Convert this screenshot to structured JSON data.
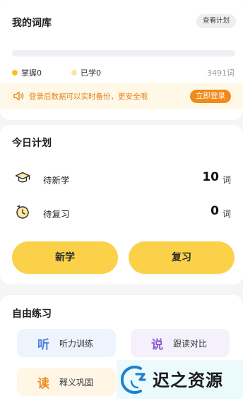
{
  "vocab": {
    "title": "我的词库",
    "plan_button": "查看计划",
    "progress": 0,
    "mastered_label": "掌握0",
    "learned_label": "已学0",
    "total_label": "3491词",
    "colors": {
      "mastered_dot": "#f8c31c",
      "learned_dot": "#fbe5a8"
    }
  },
  "login_bar": {
    "message": "登录后数据可以实时备份，更安全哦",
    "button": "立即登录",
    "icon": "speaker-icon"
  },
  "today": {
    "title": "今日计划",
    "rows": [
      {
        "label": "待新学",
        "count": "10",
        "unit": "词",
        "icon": "graduation-cap-icon"
      },
      {
        "label": "待复习",
        "count": "0",
        "unit": "词",
        "icon": "review-clock-icon"
      }
    ],
    "buttons": {
      "learn": "新学",
      "review": "复习"
    }
  },
  "practice": {
    "title": "自由练习",
    "tiles": [
      {
        "glyph": "听",
        "label": "听力训练",
        "bg": "#eef4fd",
        "glyph_color": "#4b7fd9"
      },
      {
        "glyph": "说",
        "label": "跟读对比",
        "bg": "#f4f1fc",
        "glyph_color": "#8a5ad0"
      },
      {
        "glyph": "读",
        "label": "释义巩固",
        "bg": "#fff6e6",
        "glyph_color": "#ec8a1e"
      }
    ]
  },
  "watermark": {
    "text": "迟之资源"
  }
}
